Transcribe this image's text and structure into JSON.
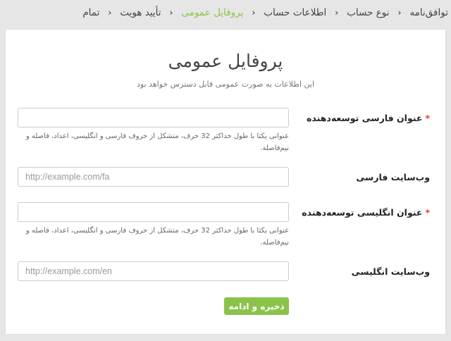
{
  "breadcrumb": {
    "steps": [
      {
        "label": "توافق‌نامه"
      },
      {
        "label": "نوع حساب"
      },
      {
        "label": "اطلاعات حساب"
      },
      {
        "label": "پروفایل عمومی"
      },
      {
        "label": "تأیید هویت"
      },
      {
        "label": "تمام"
      }
    ],
    "active_index": 3,
    "separator": "‹"
  },
  "header": {
    "title": "پروفایل عمومی",
    "subtitle": "این اطلاعات به صورت عمومی قابل دسترس خواهد بود"
  },
  "form": {
    "required_marker": "*",
    "fields": [
      {
        "label": "عنوان فارسی توسعه‌دهنده",
        "required": true,
        "value": "",
        "placeholder": "",
        "help": "عنوانی یکتا با طول حداکثر 32 حرف، متشکل از حروف فارسی و انگلیسی، اعداد، فاصله و نیم‌فاصله."
      },
      {
        "label": "وب‌سایت فارسی",
        "required": false,
        "value": "",
        "placeholder": "http://example.com/fa"
      },
      {
        "label": "عنوان انگلیسی توسعه‌دهنده",
        "required": true,
        "value": "",
        "placeholder": "",
        "help": "عنوانی یکتا با طول حداکثر 32 حرف، متشکل از حروف فارسی و انگلیسی، اعداد، فاصله و نیم‌فاصله."
      },
      {
        "label": "وب‌سایت انگلیسی",
        "required": false,
        "value": "",
        "placeholder": "http://example.com/en"
      }
    ],
    "submit_label": "ذخیره و ادامه"
  },
  "colors": {
    "accent": "#8bc34a",
    "required": "#e53935",
    "background": "#e6e6e6",
    "card": "#ffffff"
  }
}
